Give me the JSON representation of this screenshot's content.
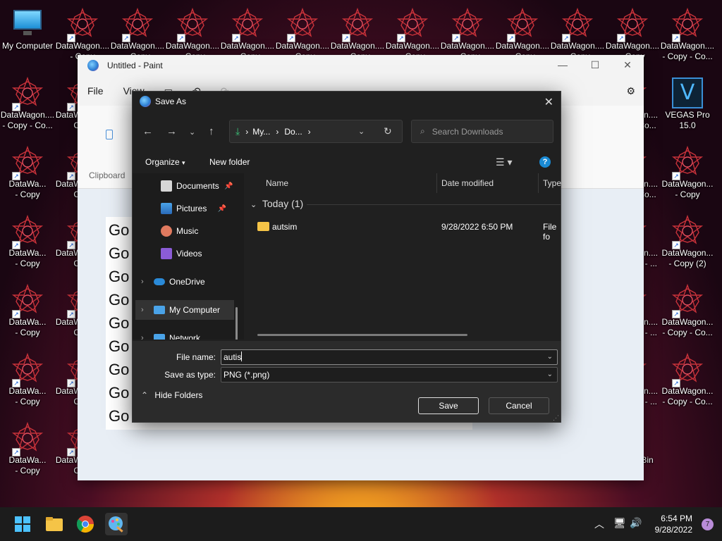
{
  "desktop": {
    "icons": [
      {
        "label": "My Computer"
      },
      {
        "label": "DataWagon....\n- Copy"
      },
      {
        "label": "DataWagon....\n- Copy"
      },
      {
        "label": "DataWagon....\n- Copy"
      },
      {
        "label": "DataWagon....\n- Copy"
      },
      {
        "label": "DataWagon....\n- Copy"
      },
      {
        "label": "DataWagon....\n- Copy"
      },
      {
        "label": "DataWagon....\n- Copy"
      },
      {
        "label": "DataWagon....\n- Copy"
      },
      {
        "label": "DataWagon....\n- Copy"
      },
      {
        "label": "DataWagon....\n- Copy"
      },
      {
        "label": "DataWagon....\n- Copy"
      },
      {
        "label": "DataWagon....\n- Copy - Co..."
      },
      {
        "label": "DataWagon....\n- Copy - Co..."
      },
      {
        "label": "DataWagon....\nCo..."
      },
      {
        "label": "DataWagon....\n- Copy - Co..."
      },
      {
        "label": "VEGAS Pro\n15.0"
      },
      {
        "label": "DataWa...\n- Copy"
      },
      {
        "label": "DataWagon....\nCo..."
      },
      {
        "label": "DataWagon....\n- Copy - Co..."
      },
      {
        "label": "DataWagon...\n- Copy"
      },
      {
        "label": "DataWa...\n- Copy"
      },
      {
        "label": "DataWagon....\nCo..."
      },
      {
        "label": "DataWagon....\n- Copy (2) - ..."
      },
      {
        "label": "DataWagon...\n- Copy (2)"
      },
      {
        "label": "DataWa...\n- Copy"
      },
      {
        "label": "DataWagon....\nCo..."
      },
      {
        "label": "DataWagon....\n- Copy (3) - ..."
      },
      {
        "label": "DataWagon...\n- Copy - Co..."
      },
      {
        "label": "DataWa...\n- Copy"
      },
      {
        "label": "DataWagon....\nCo..."
      },
      {
        "label": "DataWagon....\n- Copy (4) - ..."
      },
      {
        "label": "DataWagon...\n- Copy - Co..."
      },
      {
        "label": "DataWa...\n- Copy"
      },
      {
        "label": "DataWagon....\nCo..."
      },
      {
        "label": "Recycle Bin"
      }
    ]
  },
  "paint": {
    "title": "Untitled - Paint",
    "menu_file": "File",
    "menu_view": "View",
    "ribbon_clipboard": "Clipboard",
    "canvas_lines": [
      "Go",
      "Go",
      "Go",
      "Go",
      "Go",
      "Go",
      "Go",
      "Go",
      "Go"
    ]
  },
  "dialog": {
    "title": "Save As",
    "breadcrumb": [
      "My...",
      "Do..."
    ],
    "search_placeholder": "Search Downloads",
    "organize": "Organize",
    "new_folder": "New folder",
    "nav": {
      "documents": "Documents",
      "pictures": "Pictures",
      "music": "Music",
      "videos": "Videos",
      "onedrive": "OneDrive",
      "my_computer": "My Computer",
      "network": "Network"
    },
    "columns": {
      "name": "Name",
      "date": "Date modified",
      "type": "Type"
    },
    "group": "Today (1)",
    "files": [
      {
        "name": "autsim",
        "date": "9/28/2022 6:50 PM",
        "type": "File fo"
      }
    ],
    "file_name_label": "File name:",
    "file_name_value": "autis",
    "save_type_label": "Save as type:",
    "save_type_value": "PNG (*.png)",
    "hide_folders": "Hide Folders",
    "save": "Save",
    "cancel": "Cancel"
  },
  "taskbar": {
    "time": "6:54 PM",
    "date": "9/28/2022",
    "badge": "7"
  },
  "colors": {
    "accent": "#1a8ad4",
    "folder": "#f5c447",
    "dialog_bg": "#202020"
  }
}
